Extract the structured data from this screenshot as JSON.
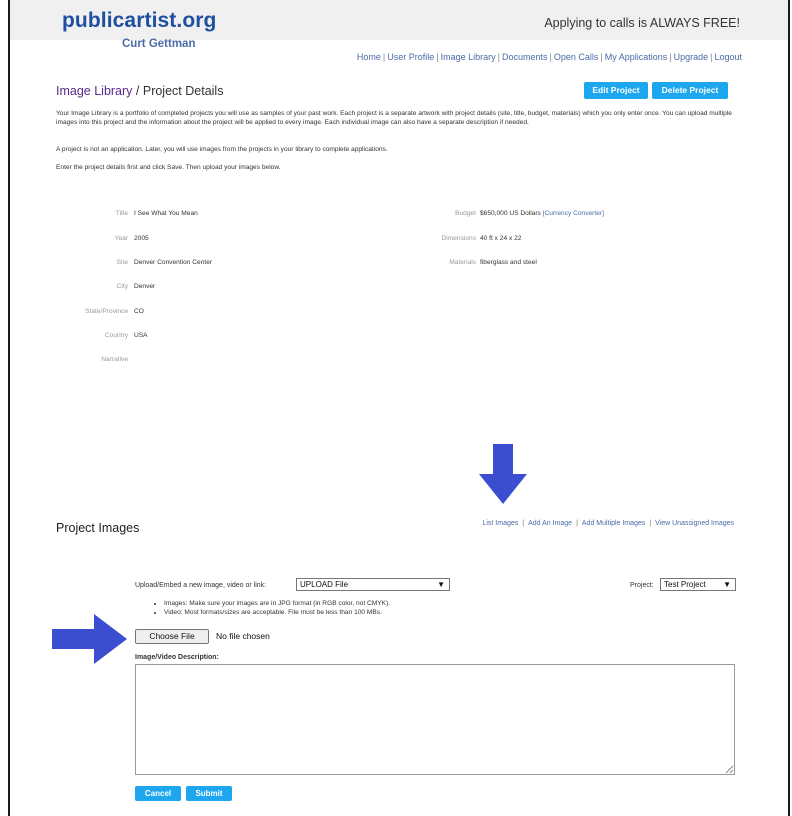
{
  "header": {
    "logo": "publicartist.org",
    "username": "Curt Gettman",
    "tagline": "Applying to calls is ALWAYS FREE!",
    "nav": [
      "Home",
      "User Profile",
      "Image Library",
      "Documents",
      "Open Calls",
      "My Applications",
      "Upgrade",
      "Logout"
    ],
    "nav_separator": "|"
  },
  "page": {
    "crumb": "Image Library",
    "crumb_sep": " / ",
    "title": "Project Details",
    "edit_button": "Edit Project",
    "delete_button": "Delete Project",
    "intro1": "Your Image Library is a portfolio of completed projects you will use as samples of your past work. Each project is a separate artwork with project details (site, title, budget, materials) which you only enter once. You can upload multiple images into this project and the information about the project will be applied to every image. Each individual image can also have a separate description if needed.",
    "intro2": "A project is not an application. Later, you will use images from the projects in your library to complete applications.",
    "intro3": "Enter the project details first and click Save. Then upload your images below."
  },
  "details": {
    "left": [
      {
        "label": "Title",
        "value": "I See What You Mean"
      },
      {
        "label": "Year",
        "value": "2005"
      },
      {
        "label": "Site",
        "value": "Denver Convention Center"
      },
      {
        "label": "City",
        "value": "Denver"
      },
      {
        "label": "State/Province",
        "value": "CO"
      },
      {
        "label": "Country",
        "value": "USA"
      },
      {
        "label": "Narrative",
        "value": ""
      }
    ],
    "right": [
      {
        "label": "Budget",
        "value": "$650,000 US Dollars",
        "link": "[Currency Converter]"
      },
      {
        "label": "Dimensions",
        "value": "40 ft x 24 x 22",
        "link": ""
      },
      {
        "label": "Materials",
        "value": "fiberglass and steel",
        "link": ""
      }
    ]
  },
  "project_images": {
    "title": "Project Images",
    "links": [
      "List Images",
      "Add An Image",
      "Add Multiple Images",
      "View Unassigned Images"
    ],
    "link_separator": "|",
    "upload_label": "Upload/Embed a new image, video or link:",
    "upload_select_value": "UPLOAD File",
    "project_label": "Project:",
    "project_select_value": "Test Project",
    "bullet_images": "Images: Make sure your images are in JPG format (in RGB color, not CMYK).",
    "bullet_video": "Video: Most formats/sizes are acceptable. File must be less than 100 MBs.",
    "choose_file": "Choose File",
    "file_status": "No file chosen",
    "description_label": "Image/Video Description:",
    "description_value": "",
    "cancel": "Cancel",
    "submit": "Submit"
  },
  "colors": {
    "brand_blue": "#1f4fa0",
    "link_blue": "#4a6ba8",
    "crumb_purple": "#5a2a8c",
    "button_blue": "#1ea7ee",
    "annotation_arrow": "#3c4ed0"
  },
  "icons": {
    "select_caret": "caret-down-icon",
    "annotation_down": "arrow-down-icon",
    "annotation_right": "arrow-right-icon"
  }
}
